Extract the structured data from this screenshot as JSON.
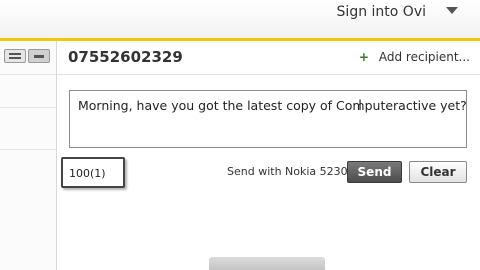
{
  "header": {
    "sign_in_label": "Sign into Ovi",
    "accent_color": "#f4c800",
    "dropdown_icon": "chevron-down-icon"
  },
  "sidebar": {
    "view_icons": [
      "list-view-icon",
      "grid-view-icon"
    ]
  },
  "compose": {
    "recipient": "07552602329",
    "add_recipient_label": "Add recipient...",
    "add_icon": "plus-icon",
    "message": "Morning, have you got the latest copy of Computeractive yet?",
    "char_counter": "100(1)",
    "send_with_label": "Send with Nokia 5230",
    "send_button": "Send",
    "clear_button": "Clear"
  }
}
